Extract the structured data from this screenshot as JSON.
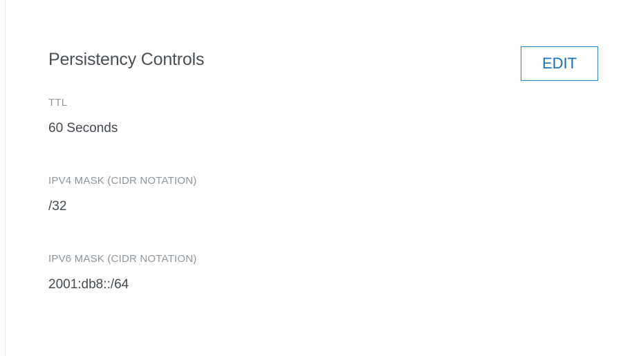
{
  "persistency_controls": {
    "title": "Persistency Controls",
    "edit_label": "EDIT",
    "fields": [
      {
        "label": "TTL",
        "value": "60 Seconds"
      },
      {
        "label": "IPV4 MASK (CIDR NOTATION)",
        "value": "/32"
      },
      {
        "label": "IPV6 MASK (CIDR NOTATION)",
        "value": "2001:db8::/64"
      }
    ]
  },
  "colors": {
    "title_text": "#4a4f54",
    "label_text": "#8e969c",
    "value_text": "#444a4f",
    "button_border": "#2d84c6",
    "button_text": "#1d6fb4",
    "divider": "#e3e6e9"
  }
}
